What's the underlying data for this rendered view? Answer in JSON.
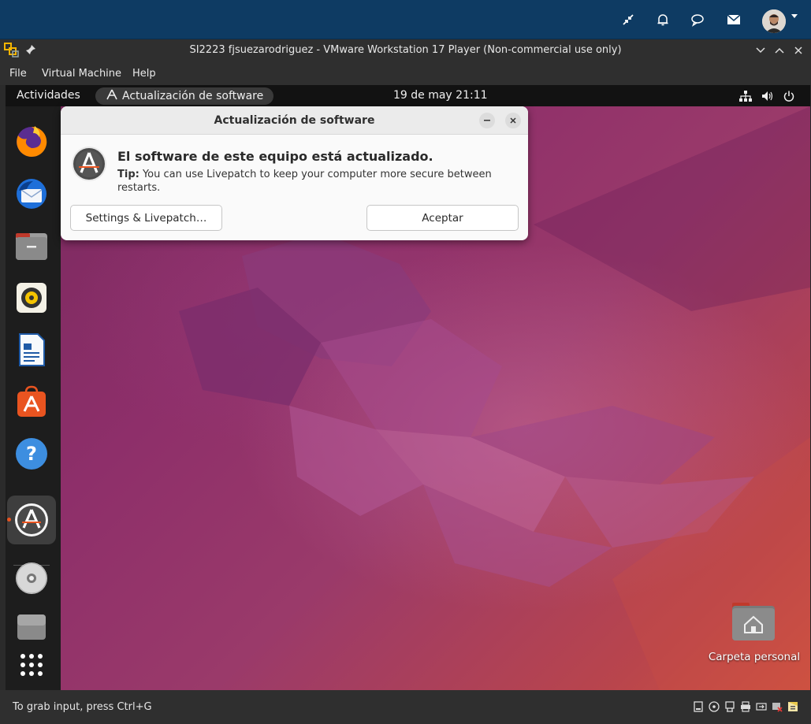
{
  "host": {
    "icons": [
      "collapse-arrows-icon",
      "bell-icon",
      "chat-bubble-icon",
      "mail-icon",
      "avatar",
      "chevron-down-icon"
    ]
  },
  "vmware": {
    "title": "SI2223 fjsuezarodriguez - VMware Workstation 17 Player (Non-commercial use only)",
    "menu": [
      "File",
      "Virtual Machine",
      "Help"
    ],
    "status_message": "To grab input, press Ctrl+G"
  },
  "guest": {
    "activities": "Actividades",
    "app_name": "Actualización de software",
    "clock": "19 de may  21:11",
    "dock": [
      "Firefox",
      "Thunderbird",
      "Files",
      "Rhythmbox",
      "LibreOffice Writer",
      "Ubuntu Software",
      "Help",
      "Software Updater",
      "DVD",
      "Disk",
      "Show Applications"
    ],
    "desktop_icon_label": "Carpeta personal"
  },
  "dialog": {
    "title": "Actualización de software",
    "heading": "El software de este equipo está actualizado.",
    "tip_label": "Tip:",
    "tip_text": " You can use Livepatch to keep your computer more secure between restarts.",
    "settings_button": "Settings & Livepatch…",
    "accept_button": "Aceptar"
  },
  "colors": {
    "host_bar": "#0e3b63",
    "vm_chrome": "#2f2f2f",
    "ubuntu_orange": "#e95420",
    "wallpaper_purple": "#8e2f6a"
  }
}
